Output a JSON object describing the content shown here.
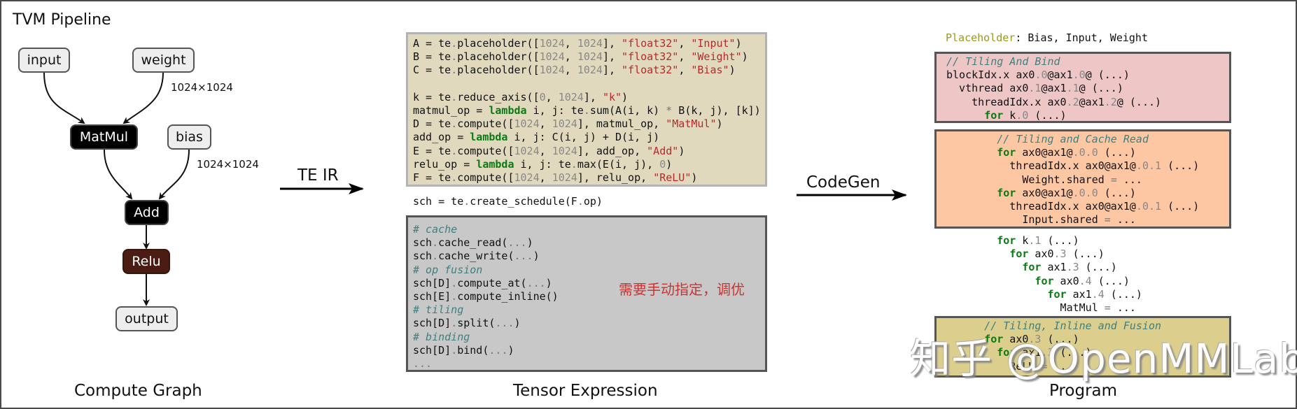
{
  "title": "TVM Pipeline",
  "graph": {
    "label": "Compute Graph",
    "nodes": {
      "input": "input",
      "weight": "weight",
      "matmul": "MatMul",
      "bias": "bias",
      "add": "Add",
      "relu": "Relu",
      "output": "output"
    },
    "edge_labels": {
      "weight_dim": "1024×1024",
      "bias_dim": "1024×1024"
    }
  },
  "arrows": {
    "te_ir": "TE IR",
    "codegen": "CodeGen"
  },
  "tensor_expression": {
    "label": "Tensor Expression",
    "definition_lines": [
      [
        [
          "A = te",
          ""
        ],
        [
          ".",
          "op"
        ],
        [
          "placeholder([",
          ""
        ],
        [
          "1024",
          "num"
        ],
        [
          ", ",
          ""
        ],
        [
          "1024",
          "num"
        ],
        [
          "], ",
          ""
        ],
        [
          "\"float32\"",
          "str"
        ],
        [
          ", ",
          ""
        ],
        [
          "\"Input\"",
          "str"
        ],
        [
          ")",
          ""
        ]
      ],
      [
        [
          "B = te",
          ""
        ],
        [
          ".",
          "op"
        ],
        [
          "placeholder([",
          ""
        ],
        [
          "1024",
          "num"
        ],
        [
          ", ",
          ""
        ],
        [
          "1024",
          "num"
        ],
        [
          "], ",
          ""
        ],
        [
          "\"float32\"",
          "str"
        ],
        [
          ", ",
          ""
        ],
        [
          "\"Weight\"",
          "str"
        ],
        [
          ")",
          ""
        ]
      ],
      [
        [
          "C = te",
          ""
        ],
        [
          ".",
          "op"
        ],
        [
          "placeholder([",
          ""
        ],
        [
          "1024",
          "num"
        ],
        [
          ", ",
          ""
        ],
        [
          "1024",
          "num"
        ],
        [
          "], ",
          ""
        ],
        [
          "\"float32\"",
          "str"
        ],
        [
          ", ",
          ""
        ],
        [
          "\"Bias\"",
          "str"
        ],
        [
          ")",
          ""
        ]
      ],
      [
        [
          " ",
          ""
        ]
      ],
      [
        [
          "k = te",
          ""
        ],
        [
          ".",
          "op"
        ],
        [
          "reduce_axis([",
          ""
        ],
        [
          "0",
          "num"
        ],
        [
          ", ",
          ""
        ],
        [
          "1024",
          "num"
        ],
        [
          "], ",
          ""
        ],
        [
          "\"k\"",
          "str"
        ],
        [
          ")",
          ""
        ]
      ],
      [
        [
          "matmul_op = ",
          ""
        ],
        [
          "lambda",
          "kw"
        ],
        [
          " i, j: te",
          ""
        ],
        [
          ".",
          "op"
        ],
        [
          "sum(A(i, k) ",
          ""
        ],
        [
          "*",
          "op"
        ],
        [
          " B(k, j), [k])",
          ""
        ]
      ],
      [
        [
          "D = te",
          ""
        ],
        [
          ".",
          "op"
        ],
        [
          "compute([",
          ""
        ],
        [
          "1024",
          "num"
        ],
        [
          ", ",
          ""
        ],
        [
          "1024",
          "num"
        ],
        [
          "], matmul_op, ",
          ""
        ],
        [
          "\"MatMul\"",
          "str"
        ],
        [
          ")",
          ""
        ]
      ],
      [
        [
          "add_op = ",
          ""
        ],
        [
          "lambda",
          "kw"
        ],
        [
          " i, j: C(i, j) + D(i, j)",
          ""
        ]
      ],
      [
        [
          "E = te",
          ""
        ],
        [
          ".",
          "op"
        ],
        [
          "compute([",
          ""
        ],
        [
          "1024",
          "num"
        ],
        [
          ", ",
          ""
        ],
        [
          "1024",
          "num"
        ],
        [
          "], add_op, ",
          ""
        ],
        [
          "\"Add\"",
          "str"
        ],
        [
          ")",
          ""
        ]
      ],
      [
        [
          "relu_op = ",
          ""
        ],
        [
          "lambda",
          "kw"
        ],
        [
          " i, j: te",
          ""
        ],
        [
          ".",
          "op"
        ],
        [
          "max(E(i, j), ",
          ""
        ],
        [
          "0",
          "num"
        ],
        [
          ")",
          ""
        ]
      ],
      [
        [
          "F = te",
          ""
        ],
        [
          ".",
          "op"
        ],
        [
          "compute([",
          ""
        ],
        [
          "1024",
          "num"
        ],
        [
          ", ",
          ""
        ],
        [
          "1024",
          "num"
        ],
        [
          "], relu_op, ",
          ""
        ],
        [
          "\"ReLU\"",
          "str"
        ],
        [
          ")",
          ""
        ]
      ]
    ],
    "schedule_line": [
      [
        "sch = te",
        ""
      ],
      [
        ".",
        "op"
      ],
      [
        "create_schedule(F",
        ""
      ],
      [
        ".",
        "op"
      ],
      [
        "op)",
        ""
      ]
    ],
    "schedule_lines": [
      [
        [
          "# cache",
          "cm"
        ]
      ],
      [
        [
          "sch",
          ""
        ],
        [
          ".",
          "op"
        ],
        [
          "cache_read(",
          ""
        ],
        [
          "...",
          "op"
        ],
        [
          ")",
          ""
        ]
      ],
      [
        [
          "sch",
          ""
        ],
        [
          ".",
          "op"
        ],
        [
          "cache_write(",
          ""
        ],
        [
          "...",
          "op"
        ],
        [
          ")",
          ""
        ]
      ],
      [
        [
          "# op fusion",
          "cm"
        ]
      ],
      [
        [
          "sch[D]",
          ""
        ],
        [
          ".",
          "op"
        ],
        [
          "compute_at(",
          ""
        ],
        [
          "...",
          "op"
        ],
        [
          ")",
          ""
        ]
      ],
      [
        [
          "sch[E]",
          ""
        ],
        [
          ".",
          "op"
        ],
        [
          "compute_inline()",
          ""
        ]
      ],
      [
        [
          "# tiling",
          "cm"
        ]
      ],
      [
        [
          "sch[D]",
          ""
        ],
        [
          ".",
          "op"
        ],
        [
          "split(",
          ""
        ],
        [
          "...",
          "op"
        ],
        [
          ")",
          ""
        ]
      ],
      [
        [
          "# binding",
          "cm"
        ]
      ],
      [
        [
          "sch[D]",
          ""
        ],
        [
          ".",
          "op"
        ],
        [
          "bind(",
          ""
        ],
        [
          "...",
          "op"
        ],
        [
          ")",
          ""
        ]
      ],
      [
        [
          "...",
          "op"
        ]
      ]
    ],
    "annotation": "需要手动指定，调优",
    "annotation_color": "#cc3333"
  },
  "program": {
    "label": "Program",
    "placeholder_line": [
      [
        "Placeholder",
        "ph"
      ],
      [
        ": Bias, Input, Weight",
        ""
      ]
    ],
    "block1_lines": [
      [
        [
          "// Tiling And Bind",
          "cm"
        ]
      ],
      [
        [
          "blockIdx.x ax0",
          ""
        ],
        [
          ".0",
          "num"
        ],
        [
          "@ax1",
          ""
        ],
        [
          ".0",
          "num"
        ],
        [
          "@ (...)",
          ""
        ]
      ],
      [
        [
          "  vthread ax0",
          ""
        ],
        [
          ".1",
          "num"
        ],
        [
          "@ax1",
          ""
        ],
        [
          ".1",
          "num"
        ],
        [
          "@ (...)",
          ""
        ]
      ],
      [
        [
          "    threadIdx.x ax0",
          ""
        ],
        [
          ".2",
          "num"
        ],
        [
          "@ax1",
          ""
        ],
        [
          ".2",
          "num"
        ],
        [
          "@ (...)",
          ""
        ]
      ],
      [
        [
          "      ",
          ""
        ],
        [
          "for",
          "kw"
        ],
        [
          " k",
          ""
        ],
        [
          ".0",
          "num"
        ],
        [
          " (...)",
          ""
        ]
      ]
    ],
    "block2_lines": [
      [
        [
          "        // Tiling and Cache Read",
          "cm"
        ]
      ],
      [
        [
          "        ",
          ""
        ],
        [
          "for",
          "kw"
        ],
        [
          " ax0@ax1@",
          ""
        ],
        [
          ".0.0",
          "num"
        ],
        [
          " (...)",
          ""
        ]
      ],
      [
        [
          "          threadIdx.x ax0@ax1@",
          ""
        ],
        [
          ".0.1",
          "num"
        ],
        [
          " (...)",
          ""
        ]
      ],
      [
        [
          "            Weight.shared ",
          ""
        ],
        [
          "=",
          "op"
        ],
        [
          " ...",
          ""
        ]
      ],
      [
        [
          "        ",
          ""
        ],
        [
          "for",
          "kw"
        ],
        [
          " ax0@ax1@",
          ""
        ],
        [
          ".0.0",
          "num"
        ],
        [
          " (...)",
          ""
        ]
      ],
      [
        [
          "          threadIdx.x ax0@ax1@",
          ""
        ],
        [
          ".0.1",
          "num"
        ],
        [
          " (...)",
          ""
        ]
      ],
      [
        [
          "            Input.shared ",
          ""
        ],
        [
          "=",
          "op"
        ],
        [
          " ...",
          ""
        ]
      ]
    ],
    "middle_lines": [
      [
        [
          "        ",
          ""
        ],
        [
          "for",
          "kw"
        ],
        [
          " k",
          ""
        ],
        [
          ".1",
          "num"
        ],
        [
          " (...)",
          ""
        ]
      ],
      [
        [
          "          ",
          ""
        ],
        [
          "for",
          "kw"
        ],
        [
          " ax0",
          ""
        ],
        [
          ".3",
          "num"
        ],
        [
          " (...)",
          ""
        ]
      ],
      [
        [
          "            ",
          ""
        ],
        [
          "for",
          "kw"
        ],
        [
          " ax1",
          ""
        ],
        [
          ".3",
          "num"
        ],
        [
          " (...)",
          ""
        ]
      ],
      [
        [
          "              ",
          ""
        ],
        [
          "for",
          "kw"
        ],
        [
          " ax0",
          ""
        ],
        [
          ".4",
          "num"
        ],
        [
          " (...)",
          ""
        ]
      ],
      [
        [
          "                ",
          ""
        ],
        [
          "for",
          "kw"
        ],
        [
          " ax1",
          ""
        ],
        [
          ".4",
          "num"
        ],
        [
          " (...)",
          ""
        ]
      ],
      [
        [
          "                  MatMul ",
          ""
        ],
        [
          "=",
          "op"
        ],
        [
          " ...",
          ""
        ]
      ]
    ],
    "block3_lines": [
      [
        [
          "      // Tiling, Inline and Fusion",
          "cm"
        ]
      ],
      [
        [
          "      ",
          ""
        ],
        [
          "for",
          "kw"
        ],
        [
          " ax0",
          ""
        ],
        [
          ".3",
          "num"
        ],
        [
          " (...)",
          ""
        ]
      ],
      [
        [
          "        ",
          ""
        ],
        [
          "for",
          "kw"
        ],
        [
          " ax1",
          ""
        ],
        [
          ".3",
          "num"
        ],
        [
          " (...)",
          ""
        ]
      ],
      [
        [
          "          ReLU ",
          ""
        ],
        [
          "=",
          "op"
        ],
        [
          " ...",
          ""
        ]
      ]
    ]
  },
  "watermark": "知乎 @OpenMMLab"
}
